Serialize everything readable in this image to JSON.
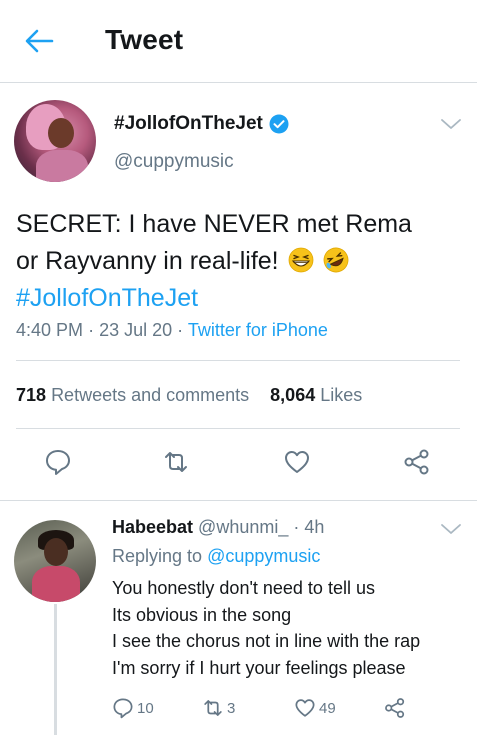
{
  "header": {
    "title": "Tweet",
    "back_icon": "arrow-left-icon"
  },
  "colors": {
    "accent": "#1da1f2",
    "secondary_text": "#657786",
    "primary_text": "#14171a",
    "divider": "#d8dde1"
  },
  "tweet": {
    "display_name": "#JollofOnTheJet",
    "handle": "@cuppymusic",
    "verified": true,
    "text_line1": "SECRET: I have NEVER met Rema",
    "text_line2": "or Rayvanny in real-life!",
    "hashtag": "#JollofOnTheJet",
    "emojis": [
      "grinning-squinting-face",
      "rolling-on-floor-laughing-face"
    ],
    "time": "4:40 PM",
    "date": "23 Jul 20",
    "source": "Twitter for iPhone",
    "retweets_count": "718",
    "retweets_label": "Retweets and comments",
    "likes_count": "8,064",
    "likes_label": "Likes",
    "actions": [
      "reply-icon",
      "retweet-icon",
      "like-icon",
      "share-icon"
    ]
  },
  "reply": {
    "name": "Habeebat",
    "handle": "@whunmi_",
    "age": "4h",
    "replying_prefix": "Replying to",
    "replying_to": "@cuppymusic",
    "lines": [
      "You honestly don't need to tell us",
      "Its obvious in the song",
      "I see the chorus not in line with the rap",
      "I'm sorry if I hurt your feelings please"
    ],
    "reply_count": "10",
    "retweet_count": "3",
    "like_count": "49"
  }
}
